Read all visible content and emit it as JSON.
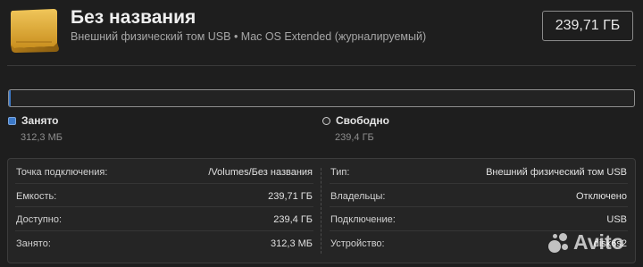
{
  "header": {
    "title": "Без названия",
    "subtitle": "Внешний физический том USB • Mac OS Extended (журналируемый)",
    "capacity": "239,71 ГБ"
  },
  "usage": {
    "used_fraction": 0.0013,
    "used_color": "#3c79c8",
    "used": {
      "label": "Занято",
      "value": "312,3 МБ"
    },
    "free": {
      "label": "Свободно",
      "value": "239,4 ГБ"
    }
  },
  "info": {
    "left": [
      {
        "key": "Точка подключения:",
        "value": "/Volumes/Без названия"
      },
      {
        "key": "Емкость:",
        "value": "239,71 ГБ"
      },
      {
        "key": "Доступно:",
        "value": "239,4 ГБ"
      },
      {
        "key": "Занято:",
        "value": "312,3 МБ"
      }
    ],
    "right": [
      {
        "key": "Тип:",
        "value": "Внешний физический том USB"
      },
      {
        "key": "Владельцы:",
        "value": "Отключено"
      },
      {
        "key": "Подключение:",
        "value": "USB"
      },
      {
        "key": "Устройство:",
        "value": "disk6s2"
      }
    ]
  },
  "watermark": "Avito"
}
